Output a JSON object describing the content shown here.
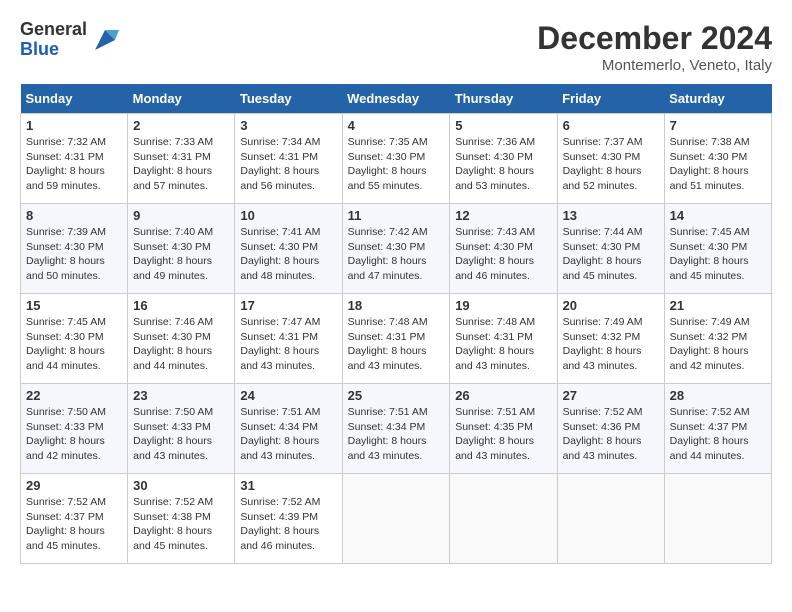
{
  "header": {
    "logo_general": "General",
    "logo_blue": "Blue",
    "title": "December 2024",
    "location": "Montemerlo, Veneto, Italy"
  },
  "days_of_week": [
    "Sunday",
    "Monday",
    "Tuesday",
    "Wednesday",
    "Thursday",
    "Friday",
    "Saturday"
  ],
  "weeks": [
    [
      {
        "day": 1,
        "sunrise": "7:32 AM",
        "sunset": "4:31 PM",
        "daylight": "8 hours and 59 minutes."
      },
      {
        "day": 2,
        "sunrise": "7:33 AM",
        "sunset": "4:31 PM",
        "daylight": "8 hours and 57 minutes."
      },
      {
        "day": 3,
        "sunrise": "7:34 AM",
        "sunset": "4:31 PM",
        "daylight": "8 hours and 56 minutes."
      },
      {
        "day": 4,
        "sunrise": "7:35 AM",
        "sunset": "4:30 PM",
        "daylight": "8 hours and 55 minutes."
      },
      {
        "day": 5,
        "sunrise": "7:36 AM",
        "sunset": "4:30 PM",
        "daylight": "8 hours and 53 minutes."
      },
      {
        "day": 6,
        "sunrise": "7:37 AM",
        "sunset": "4:30 PM",
        "daylight": "8 hours and 52 minutes."
      },
      {
        "day": 7,
        "sunrise": "7:38 AM",
        "sunset": "4:30 PM",
        "daylight": "8 hours and 51 minutes."
      }
    ],
    [
      {
        "day": 8,
        "sunrise": "7:39 AM",
        "sunset": "4:30 PM",
        "daylight": "8 hours and 50 minutes."
      },
      {
        "day": 9,
        "sunrise": "7:40 AM",
        "sunset": "4:30 PM",
        "daylight": "8 hours and 49 minutes."
      },
      {
        "day": 10,
        "sunrise": "7:41 AM",
        "sunset": "4:30 PM",
        "daylight": "8 hours and 48 minutes."
      },
      {
        "day": 11,
        "sunrise": "7:42 AM",
        "sunset": "4:30 PM",
        "daylight": "8 hours and 47 minutes."
      },
      {
        "day": 12,
        "sunrise": "7:43 AM",
        "sunset": "4:30 PM",
        "daylight": "8 hours and 46 minutes."
      },
      {
        "day": 13,
        "sunrise": "7:44 AM",
        "sunset": "4:30 PM",
        "daylight": "8 hours and 45 minutes."
      },
      {
        "day": 14,
        "sunrise": "7:45 AM",
        "sunset": "4:30 PM",
        "daylight": "8 hours and 45 minutes."
      }
    ],
    [
      {
        "day": 15,
        "sunrise": "7:45 AM",
        "sunset": "4:30 PM",
        "daylight": "8 hours and 44 minutes."
      },
      {
        "day": 16,
        "sunrise": "7:46 AM",
        "sunset": "4:30 PM",
        "daylight": "8 hours and 44 minutes."
      },
      {
        "day": 17,
        "sunrise": "7:47 AM",
        "sunset": "4:31 PM",
        "daylight": "8 hours and 43 minutes."
      },
      {
        "day": 18,
        "sunrise": "7:48 AM",
        "sunset": "4:31 PM",
        "daylight": "8 hours and 43 minutes."
      },
      {
        "day": 19,
        "sunrise": "7:48 AM",
        "sunset": "4:31 PM",
        "daylight": "8 hours and 43 minutes."
      },
      {
        "day": 20,
        "sunrise": "7:49 AM",
        "sunset": "4:32 PM",
        "daylight": "8 hours and 43 minutes."
      },
      {
        "day": 21,
        "sunrise": "7:49 AM",
        "sunset": "4:32 PM",
        "daylight": "8 hours and 42 minutes."
      }
    ],
    [
      {
        "day": 22,
        "sunrise": "7:50 AM",
        "sunset": "4:33 PM",
        "daylight": "8 hours and 42 minutes."
      },
      {
        "day": 23,
        "sunrise": "7:50 AM",
        "sunset": "4:33 PM",
        "daylight": "8 hours and 43 minutes."
      },
      {
        "day": 24,
        "sunrise": "7:51 AM",
        "sunset": "4:34 PM",
        "daylight": "8 hours and 43 minutes."
      },
      {
        "day": 25,
        "sunrise": "7:51 AM",
        "sunset": "4:34 PM",
        "daylight": "8 hours and 43 minutes."
      },
      {
        "day": 26,
        "sunrise": "7:51 AM",
        "sunset": "4:35 PM",
        "daylight": "8 hours and 43 minutes."
      },
      {
        "day": 27,
        "sunrise": "7:52 AM",
        "sunset": "4:36 PM",
        "daylight": "8 hours and 43 minutes."
      },
      {
        "day": 28,
        "sunrise": "7:52 AM",
        "sunset": "4:37 PM",
        "daylight": "8 hours and 44 minutes."
      }
    ],
    [
      {
        "day": 29,
        "sunrise": "7:52 AM",
        "sunset": "4:37 PM",
        "daylight": "8 hours and 45 minutes."
      },
      {
        "day": 30,
        "sunrise": "7:52 AM",
        "sunset": "4:38 PM",
        "daylight": "8 hours and 45 minutes."
      },
      {
        "day": 31,
        "sunrise": "7:52 AM",
        "sunset": "4:39 PM",
        "daylight": "8 hours and 46 minutes."
      },
      null,
      null,
      null,
      null
    ]
  ]
}
